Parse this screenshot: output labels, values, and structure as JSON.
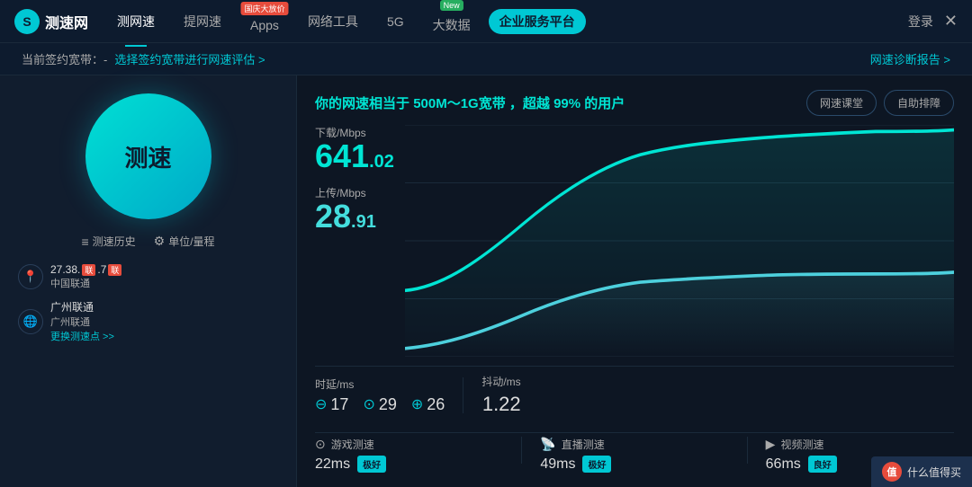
{
  "logo": {
    "icon": "S",
    "text": "测速网"
  },
  "nav": {
    "items": [
      {
        "label": "测网速",
        "active": true
      },
      {
        "label": "提网速",
        "active": false,
        "badge": null
      },
      {
        "label": "Apps",
        "active": false,
        "badge": "国庆大放价"
      },
      {
        "label": "网络工具",
        "active": false
      },
      {
        "label": "5G",
        "active": false
      },
      {
        "label": "大数据",
        "active": false,
        "badge": "New"
      },
      {
        "label": "企业服务平台",
        "active": false,
        "enterprise": true
      }
    ],
    "login": "登录",
    "close": "✕"
  },
  "subheader": {
    "prefix": "当前签约宽带：-",
    "link": "选择签约宽带进行网速评估 >",
    "right": "网速诊断报告 >"
  },
  "left_panel": {
    "speed_button": "测速",
    "controls": [
      {
        "icon": "≡",
        "label": "测速历史"
      },
      {
        "icon": "⚙",
        "label": "单位/量程"
      }
    ],
    "ip_info": {
      "ip": "27.38.",
      "ip_flag": "联",
      "ip_end": ".7",
      "ip_flag2": "联",
      "isp": "中国联通"
    },
    "location": {
      "name": "广州联通",
      "isp": "广州联通",
      "link": "更换测速点 >>"
    }
  },
  "result": {
    "text_prefix": "你的网速相当于",
    "speed_range": "500M～1G宽带",
    "text_suffix": "，超越",
    "percent": "99%",
    "text_end": "的用户",
    "buttons": [
      "网速课堂",
      "自助排障"
    ]
  },
  "download": {
    "label": "下载/Mbps",
    "value": "641",
    "decimal": ".02"
  },
  "upload": {
    "label": "上传/Mbps",
    "value": "28",
    "decimal": ".91"
  },
  "latency": {
    "label": "时延/ms",
    "values": [
      {
        "icon": "⊖",
        "value": "17"
      },
      {
        "icon": "⊙",
        "value": "29"
      },
      {
        "icon": "⊕",
        "value": "26"
      }
    ],
    "jitter_label": "抖动/ms",
    "jitter_value": "1.22"
  },
  "features": [
    {
      "icon": "⊙",
      "label": "游戏测速",
      "ms": "22ms",
      "badge": "极好"
    },
    {
      "icon": "📺",
      "label": "直播测速",
      "ms": "49ms",
      "badge": "极好"
    },
    {
      "icon": "▶",
      "label": "视频测速",
      "ms": "66ms",
      "badge": "良好"
    }
  ],
  "watermark": {
    "circle": "值",
    "text": "什么值得买"
  },
  "colors": {
    "download": "#00e5d4",
    "upload": "#4dd0dd",
    "accent": "#00c8d4"
  }
}
